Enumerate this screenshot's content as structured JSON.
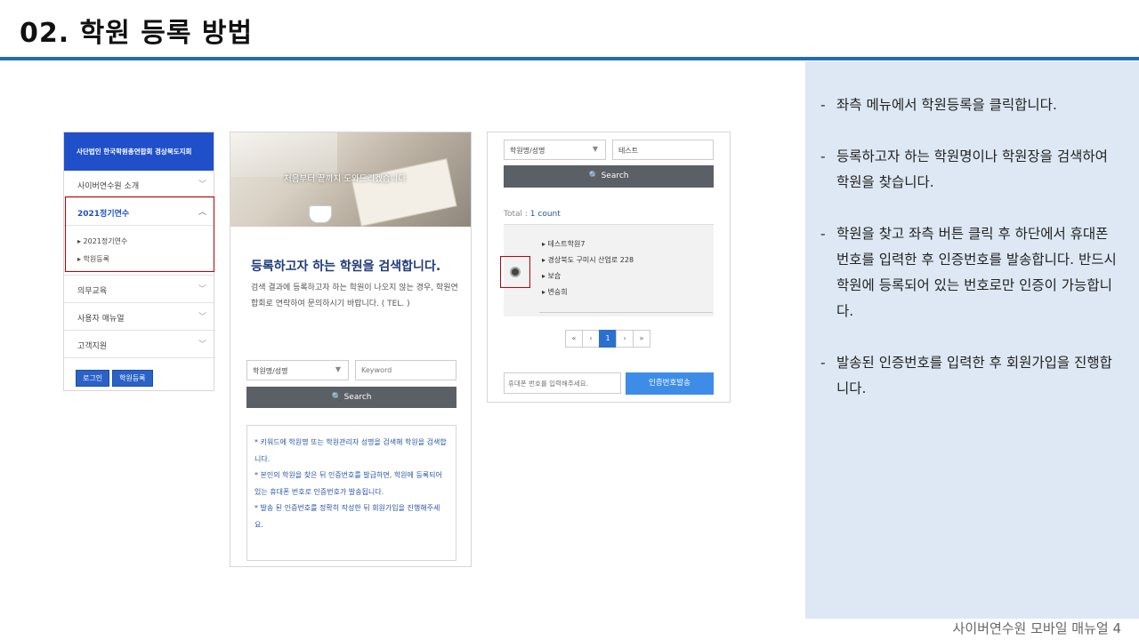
{
  "slide": {
    "title": "02. 학원 등록 방법",
    "footer": "사이버연수원 모바일 매뉴얼  4"
  },
  "instructions": [
    "좌측 메뉴에서 학원등록을 클릭합니다.",
    "등록하고자 하는 학원명이나 학원장을 검색하여 학원을 찾습니다.",
    "학원을 찾고 좌측 버튼 클릭 후 하단에서 휴대폰 번호를 입력한 후 인증번호를 발송합니다. 반드시 학원에 등록되어 있는 번호로만 인증이 가능합니다.",
    "발송된 인증번호를 입력한 후 회원가입을 진행합니다."
  ],
  "screen1": {
    "header": "사단법인 한국학원총연합회 경상북도지회",
    "menu": {
      "item1": "사이버연수원 소개",
      "item2": "2021정기연수",
      "sub1": "▸ 2021정기연수",
      "sub2": "▸ 학원등록",
      "item3": "의무교육",
      "item4": "사용자 매뉴얼",
      "item5": "고객지원"
    },
    "login_button": "로그인",
    "register_button": "학원등록",
    "colors": {
      "header": "#1f4fc9",
      "highlight": "#c00000"
    }
  },
  "screen2": {
    "hero_text": "처음부터 끝까지 도와드리겠습니다",
    "heading": "등록하고자 하는 학원을 검색합니다.",
    "description": "검색 결과에 등록하고자 하는 학원이 나오지 않는 경우, 학원연합회로 연락하여 문의하시기 바랍니다. ( TEL. )",
    "select_value": "학원명/성명",
    "keyword_placeholder": "Keyword",
    "search_label": "Search",
    "notes": [
      "* 키워드에 학원명 또는 학원관리자 성명을 검색해 학원을 검색합니다.",
      "* 본인의 학원을 찾은 뒤 인증번호를 발급하면, 학원에 등록되어있는 휴대폰 번호로 인증번호가 발송됩니다.",
      "* 발송 된 인증번호를 정확히 작성한 뒤 회원가입을 진행해주세요."
    ]
  },
  "screen3": {
    "select_value": "학원명/성명",
    "keyword_value": "테스트",
    "search_label": "Search",
    "total_label": "Total :",
    "total_count": "1 count",
    "result": {
      "name": "▸ 테스트학원7",
      "address": "▸ 경상북도 구미시 산업로 228",
      "category": "▸ 보습",
      "type": "▸ 변승희"
    },
    "pager": {
      "first": "«",
      "prev": "‹",
      "current": "1",
      "next": "›",
      "last": "»"
    },
    "phone_placeholder": "휴대폰 번호를 입력해주세요.",
    "send_button": "인증번호발송"
  }
}
